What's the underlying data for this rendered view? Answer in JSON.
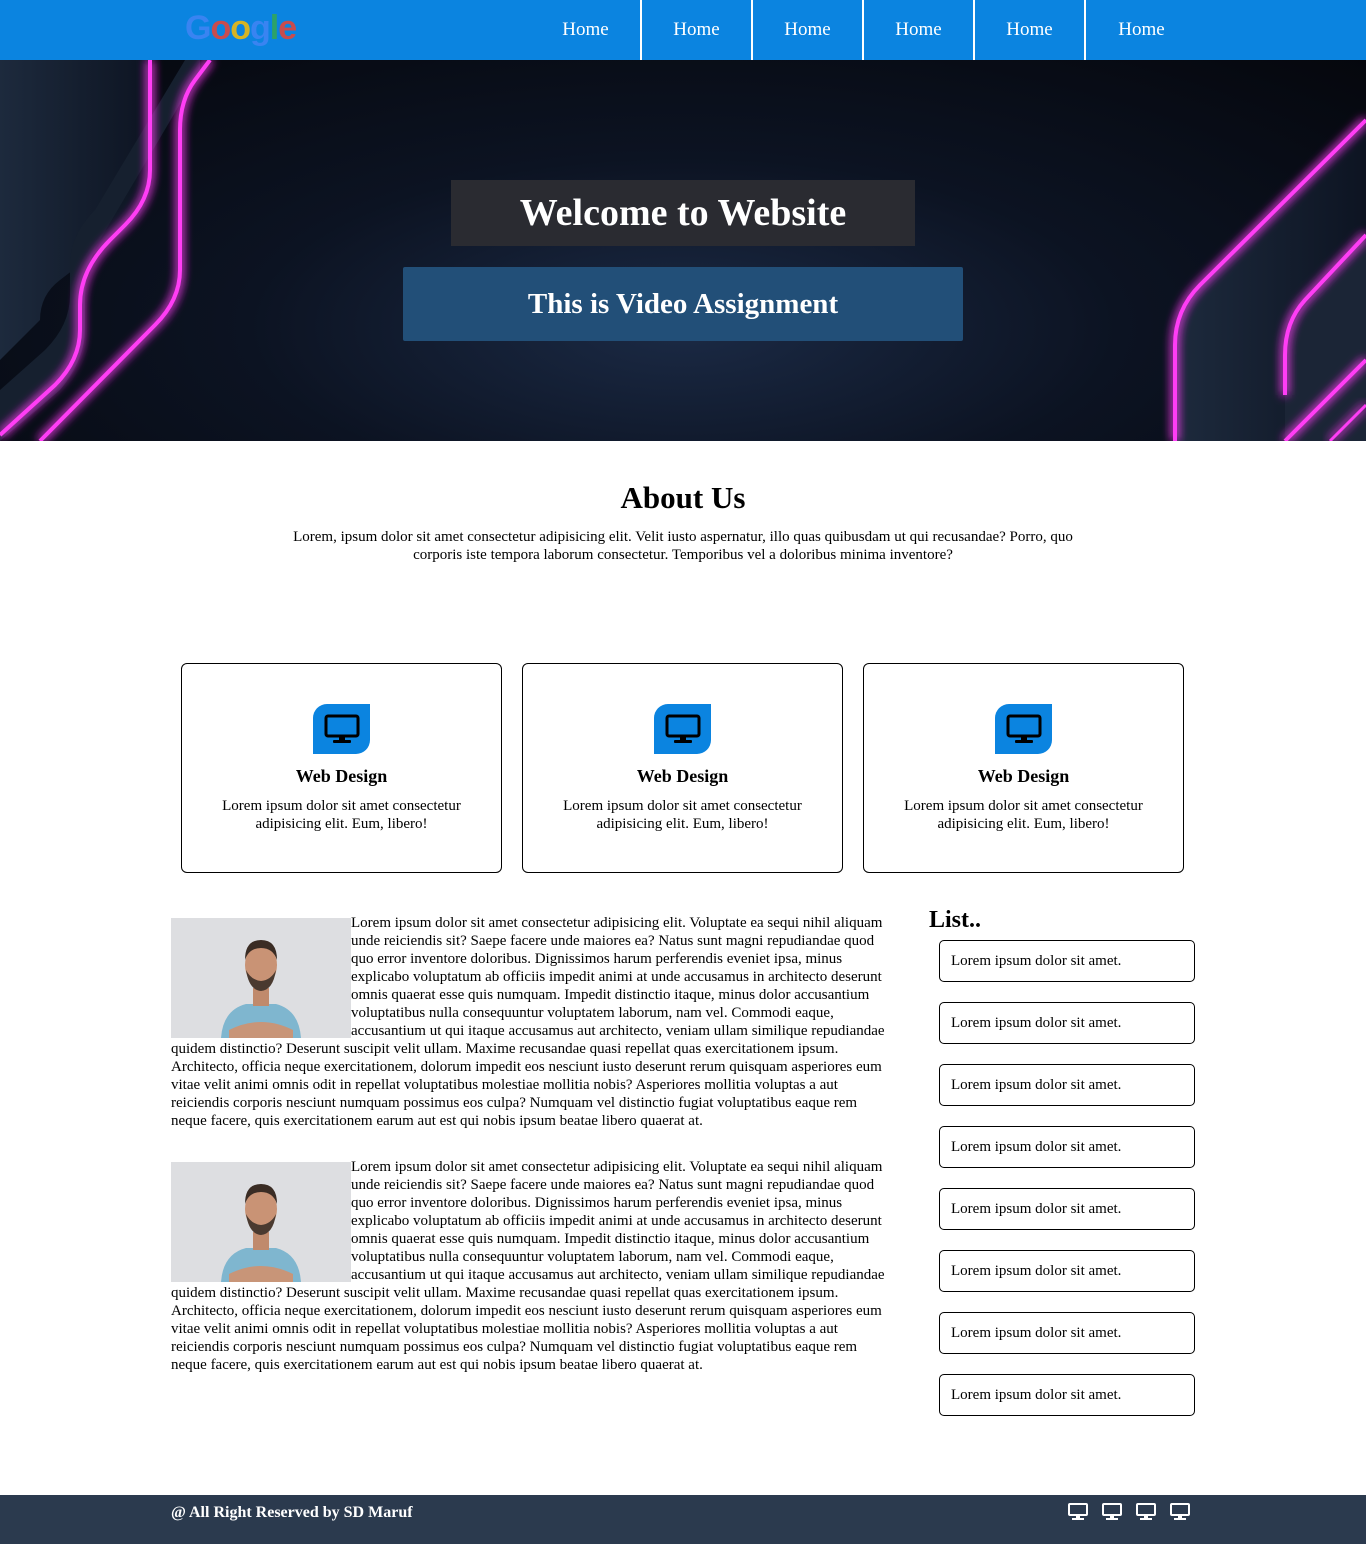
{
  "nav": {
    "logo_letters": [
      "G",
      "o",
      "o",
      "g",
      "l",
      "e"
    ],
    "items": [
      "Home",
      "Home",
      "Home",
      "Home",
      "Home",
      "Home"
    ]
  },
  "hero": {
    "title": "Welcome to Website",
    "subtitle": "This is Video Assignment"
  },
  "about": {
    "title": "About Us",
    "text": "Lorem, ipsum dolor sit amet consectetur adipisicing elit. Velit iusto aspernatur, illo quas quibusdam ut qui recusandae? Porro, quo corporis iste tempora laborum consectetur. Temporibus vel a doloribus minima inventore?"
  },
  "services": [
    {
      "icon": "monitor-icon",
      "title": "Web Design",
      "text": "Lorem ipsum dolor sit amet consectetur adipisicing elit. Eum, libero!"
    },
    {
      "icon": "monitor-icon",
      "title": "Web Design",
      "text": "Lorem ipsum dolor sit amet consectetur adipisicing elit. Eum, libero!"
    },
    {
      "icon": "monitor-icon",
      "title": "Web Design",
      "text": "Lorem ipsum dolor sit amet consectetur adipisicing elit. Eum, libero!"
    }
  ],
  "articles": [
    {
      "text": "Lorem ipsum dolor sit amet consectetur adipisicing elit. Voluptate ea sequi nihil aliquam unde reiciendis sit? Saepe facere unde maiores ea? Natus sunt magni repudiandae quod quo error inventore doloribus. Dignissimos harum perferendis eveniet ipsa, minus explicabo voluptatum ab officiis impedit animi at unde accusamus in architecto deserunt omnis quaerat esse quis numquam. Impedit distinctio itaque, minus dolor accusantium voluptatibus nulla consequuntur voluptatem laborum, nam vel. Commodi eaque, accusantium ut qui itaque accusamus aut architecto, veniam ullam similique repudiandae quidem distinctio? Deserunt suscipit velit ullam. Maxime recusandae quasi repellat quas exercitationem ipsum. Architecto, officia neque exercitationem, dolorum impedit eos nesciunt iusto deserunt rerum quisquam asperiores eum vitae velit animi omnis odit in repellat voluptatibus molestiae mollitia nobis? Asperiores mollitia voluptas a aut reiciendis corporis nesciunt numquam possimus eos culpa? Numquam vel distinctio fugiat voluptatibus eaque rem neque facere, quis exercitationem earum aut est qui nobis ipsum beatae libero quaerat at."
    },
    {
      "text": "Lorem ipsum dolor sit amet consectetur adipisicing elit. Voluptate ea sequi nihil aliquam unde reiciendis sit? Saepe facere unde maiores ea? Natus sunt magni repudiandae quod quo error inventore doloribus. Dignissimos harum perferendis eveniet ipsa, minus explicabo voluptatum ab officiis impedit animi at unde accusamus in architecto deserunt omnis quaerat esse quis numquam. Impedit distinctio itaque, minus dolor accusantium voluptatibus nulla consequuntur voluptatem laborum, nam vel. Commodi eaque, accusantium ut qui itaque accusamus aut architecto, veniam ullam similique repudiandae quidem distinctio? Deserunt suscipit velit ullam. Maxime recusandae quasi repellat quas exercitationem ipsum. Architecto, officia neque exercitationem, dolorum impedit eos nesciunt iusto deserunt rerum quisquam asperiores eum vitae velit animi omnis odit in repellat voluptatibus molestiae mollitia nobis? Asperiores mollitia voluptas a aut reiciendis corporis nesciunt numquam possimus eos culpa? Numquam vel distinctio fugiat voluptatibus eaque rem neque facere, quis exercitationem earum aut est qui nobis ipsum beatae libero quaerat at."
    }
  ],
  "sidebar": {
    "title": "List..",
    "items": [
      "Lorem ipsum dolor sit amet.",
      "Lorem ipsum dolor sit amet.",
      "Lorem ipsum dolor sit amet.",
      "Lorem ipsum dolor sit amet.",
      "Lorem ipsum dolor sit amet.",
      "Lorem ipsum dolor sit amet.",
      "Lorem ipsum dolor sit amet.",
      "Lorem ipsum dolor sit amet."
    ]
  },
  "footer": {
    "text": "@ All Right Reserved by SD Maruf",
    "icons": [
      "monitor-icon",
      "monitor-icon",
      "monitor-icon",
      "monitor-icon"
    ]
  },
  "colors": {
    "nav": "#0b84e0",
    "accent": "#0b84e0",
    "footer": "#2b3a4e",
    "hero_title_bg": "#2a2b31",
    "hero_sub_bg": "#224f78",
    "neon": "#ff3df5"
  }
}
